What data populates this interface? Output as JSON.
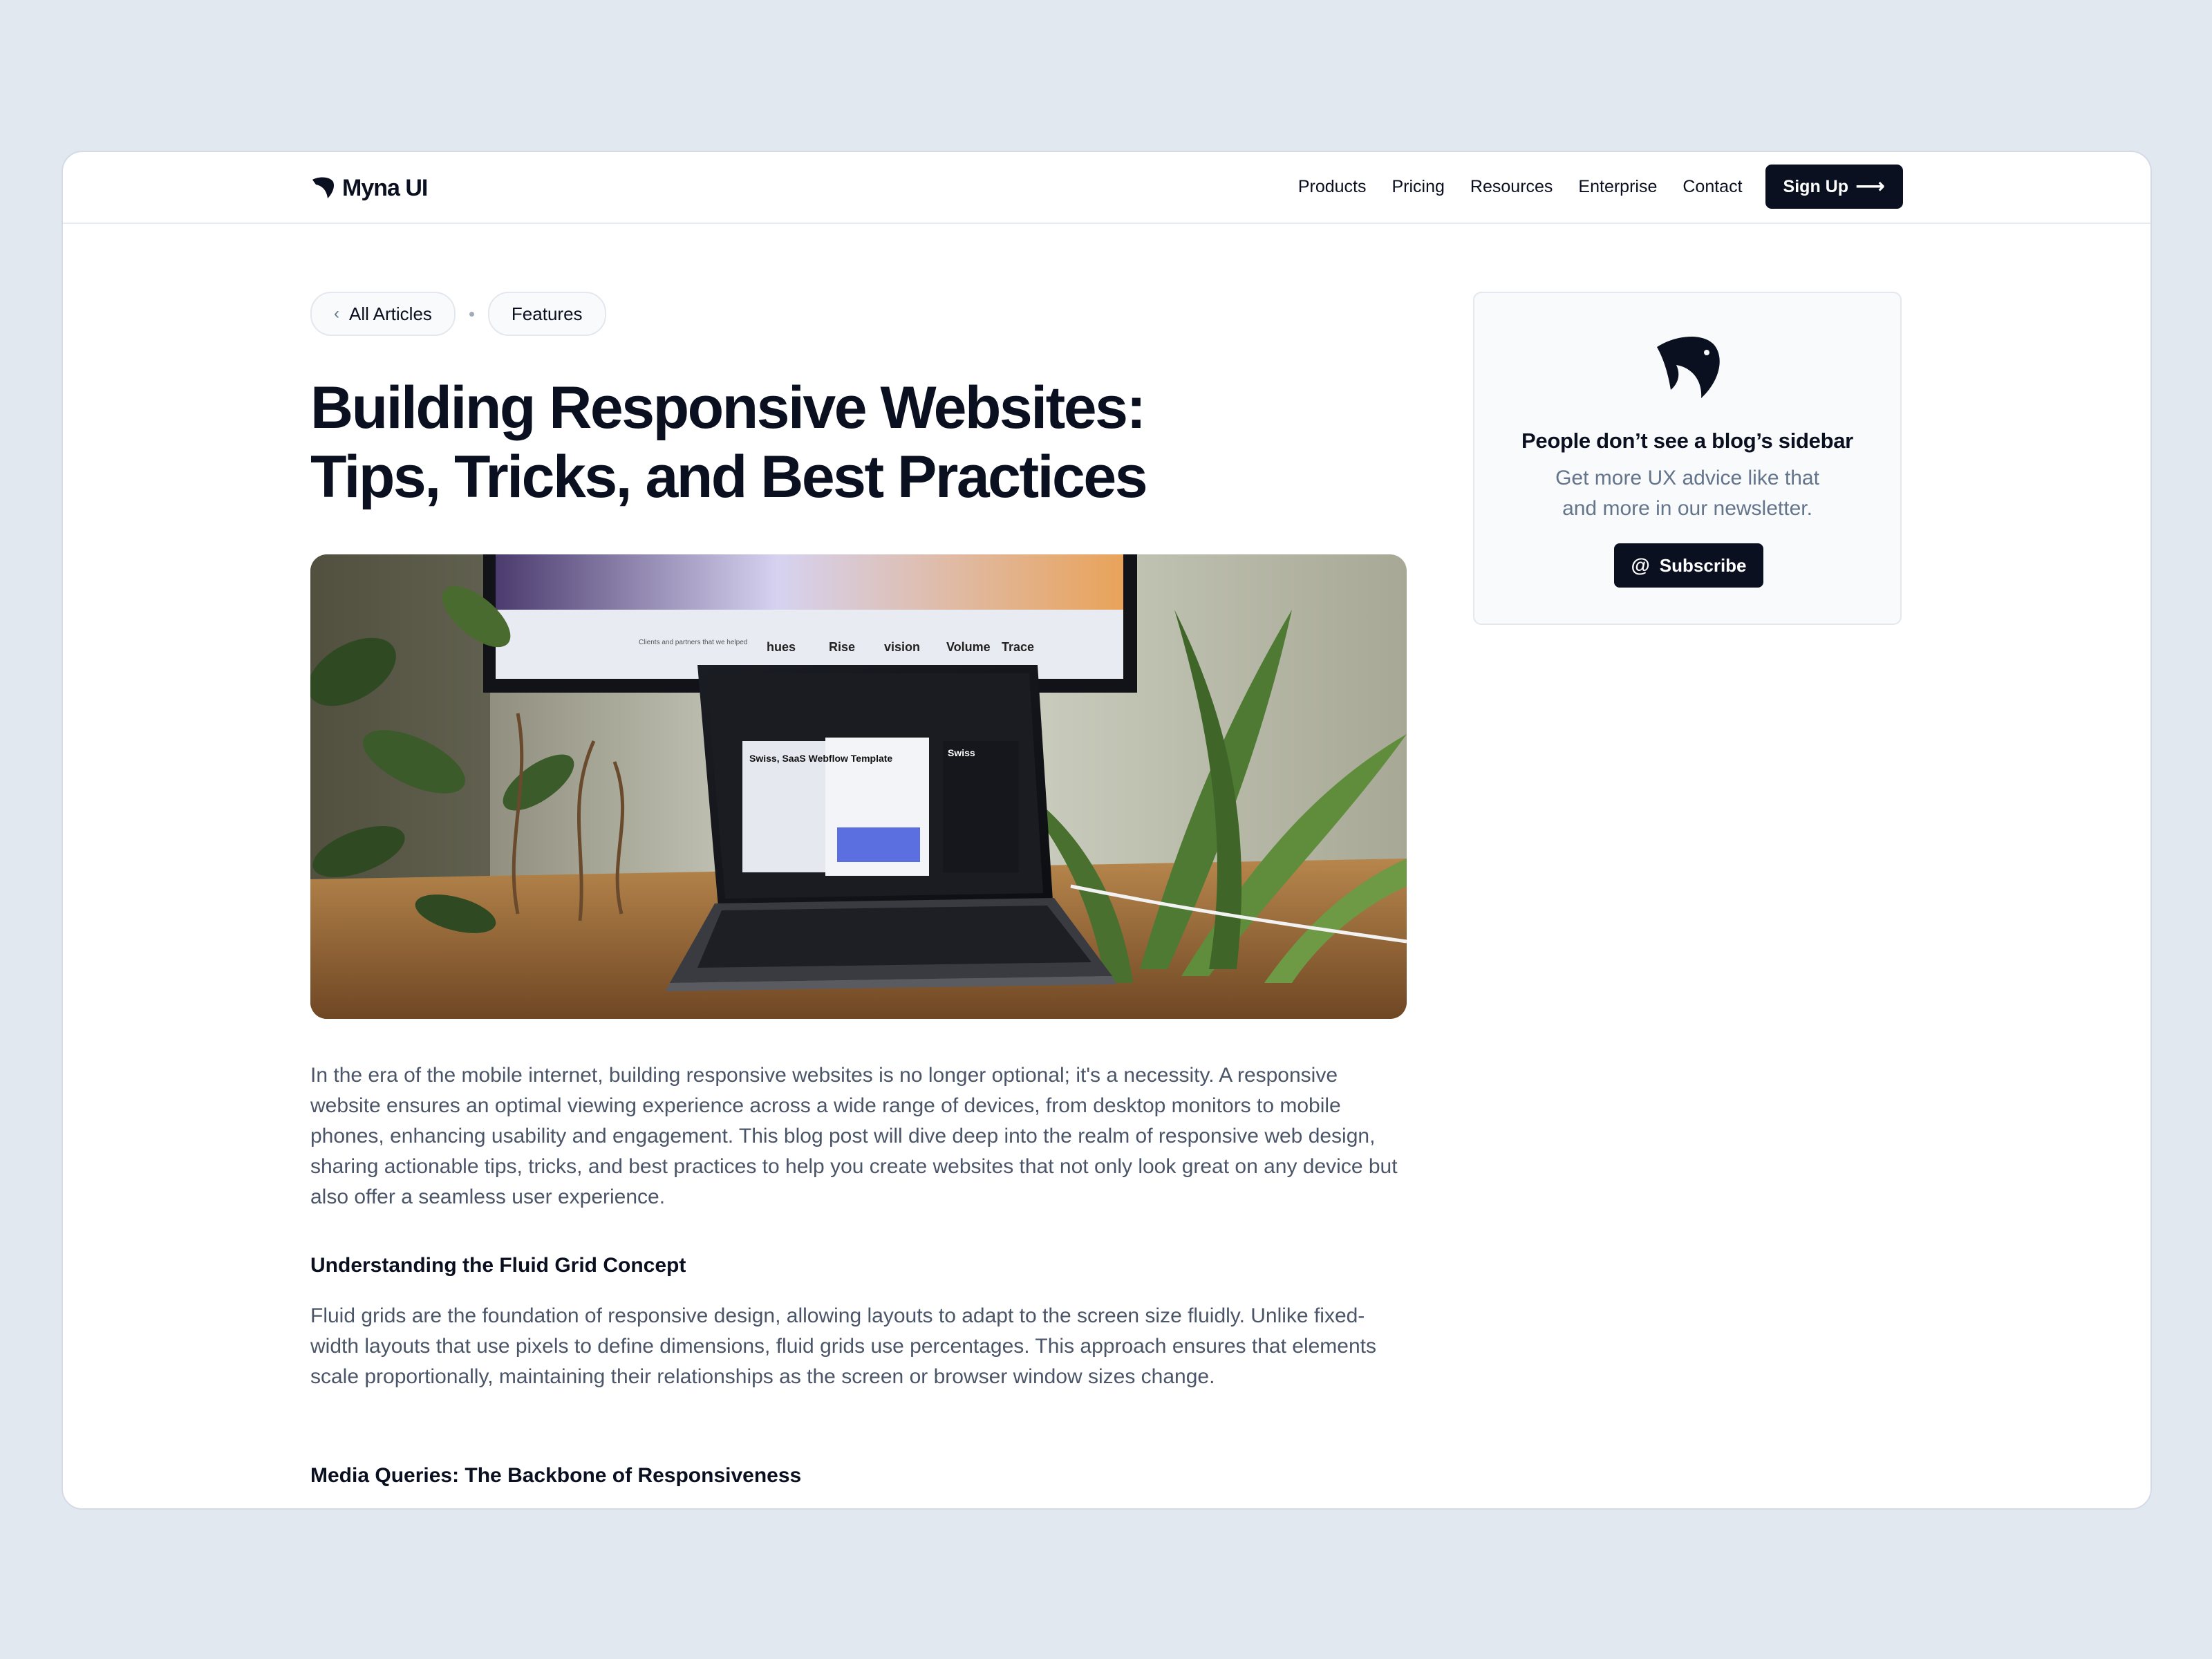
{
  "nav": {
    "brand": "Myna UI",
    "links": [
      "Products",
      "Pricing",
      "Resources",
      "Enterprise",
      "Contact"
    ],
    "signup_label": "Sign Up",
    "signup_icon": "arrow-right-icon"
  },
  "breadcrumb": {
    "back_label": "All Articles",
    "back_icon": "chevron-left-icon",
    "category": "Features"
  },
  "article": {
    "title_line1": "Building Responsive Websites:",
    "title_line2": "Tips, Tricks, and Best Practices",
    "hero_image": {
      "monitor_brands": [
        "hues",
        "Rise",
        "vision",
        "Volume",
        "Trace"
      ],
      "monitor_caption": "Clients and partners that we helped",
      "laptop_card_title": "Swiss, SaaS Webflow Template",
      "laptop_side_title": "Swiss"
    },
    "intro": "In the era of the mobile internet, building responsive websites is no longer optional; it's a necessity. A responsive website ensures an optimal viewing experience across a wide range of devices, from desktop monitors to mobile phones, enhancing usability and engagement. This blog post will dive deep into the realm of responsive web design, sharing actionable tips, tricks, and best practices to help you create websites that not only look great on any device but also offer a seamless user experience.",
    "section1_heading": "Understanding the Fluid Grid Concept",
    "section1_body": "Fluid grids are the foundation of responsive design, allowing layouts to adapt to the screen size fluidly. Unlike fixed-width layouts that use pixels to define dimensions, fluid grids use percentages. This approach ensures that elements scale proportionally, maintaining their relationships as the screen or browser window sizes change.",
    "section2_heading": "Media Queries: The Backbone of Responsiveness"
  },
  "sidebar": {
    "title": "People don’t see a blog’s sidebar",
    "text": "Get more UX advice like that and more in our newsletter.",
    "subscribe_label": "Subscribe",
    "subscribe_icon": "at-sign-icon"
  },
  "colors": {
    "page_bg": "#e2e8f0",
    "primary": "#0b1020",
    "muted_text": "#64748b",
    "body_text": "#4b5568"
  }
}
